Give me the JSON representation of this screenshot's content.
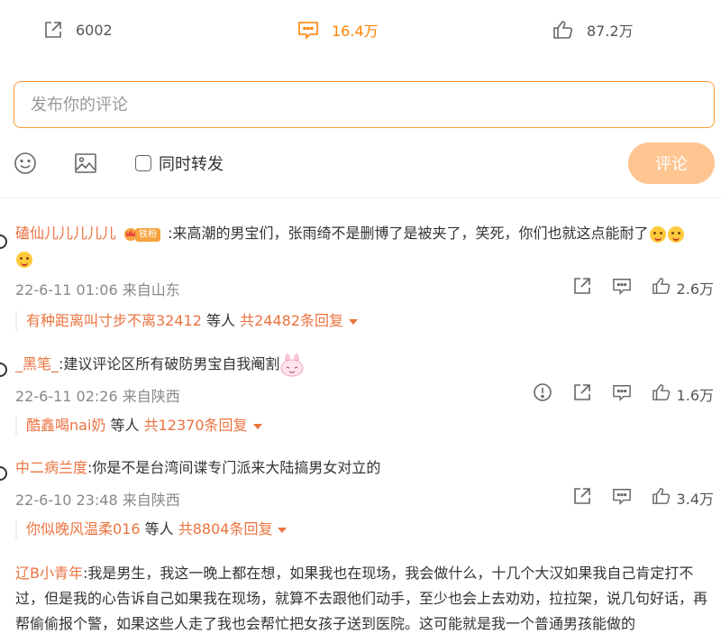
{
  "action_bar": {
    "share_count": "6002",
    "comment_count": "16.4万",
    "like_count": "87.2万"
  },
  "composer": {
    "placeholder": "发布你的评论",
    "repost_label": "同时转发",
    "submit_label": "评论"
  },
  "colors": {
    "accent": "#ff8200",
    "username": "#eb7340",
    "submit_disabled": "#ffc591"
  },
  "comments": [
    {
      "user": "磕仙儿儿儿儿儿",
      "badge": "铁粉",
      "text": ":来高潮的男宝们，张雨绮不是删博了是被夹了，笑死，你们也就这点能耐了",
      "meta": "22-6-11 01:06 来自山东",
      "likes": "2.6万",
      "reply_user": "有种距离叫寸步不离32412",
      "reply_etc": "等人",
      "reply_count": "共24482条回复"
    },
    {
      "user": "_黑笔_",
      "text": ":建议评论区所有破防男宝自我阉割",
      "meta": "22-6-11 02:26 来自陕西",
      "likes": "1.6万",
      "reply_user": "酷鑫喝nai奶",
      "reply_etc": "等人",
      "reply_count": "共12370条回复"
    },
    {
      "user": "中二病兰度",
      "text": ":你是不是台湾间谍专门派来大陆搞男女对立的",
      "meta": "22-6-10 23:48 来自陕西",
      "likes": "3.4万",
      "reply_user": "你似晚风温柔016",
      "reply_etc": "等人",
      "reply_count": "共8804条回复"
    },
    {
      "user": "辽B小青年",
      "text": ":我是男生，我这一晚上都在想，如果我也在现场，我会做什么，十几个大汉如果我自己肯定打不过，但是我的心告诉自己如果我在现场，就算不去跟他们动手，至少也会上去劝劝，拉拉架，说几句好话，再帮偷偷报个警，如果这些人走了我也会帮忙把女孩子送到医院。这可能就是我一个普通男孩能做的"
    }
  ]
}
